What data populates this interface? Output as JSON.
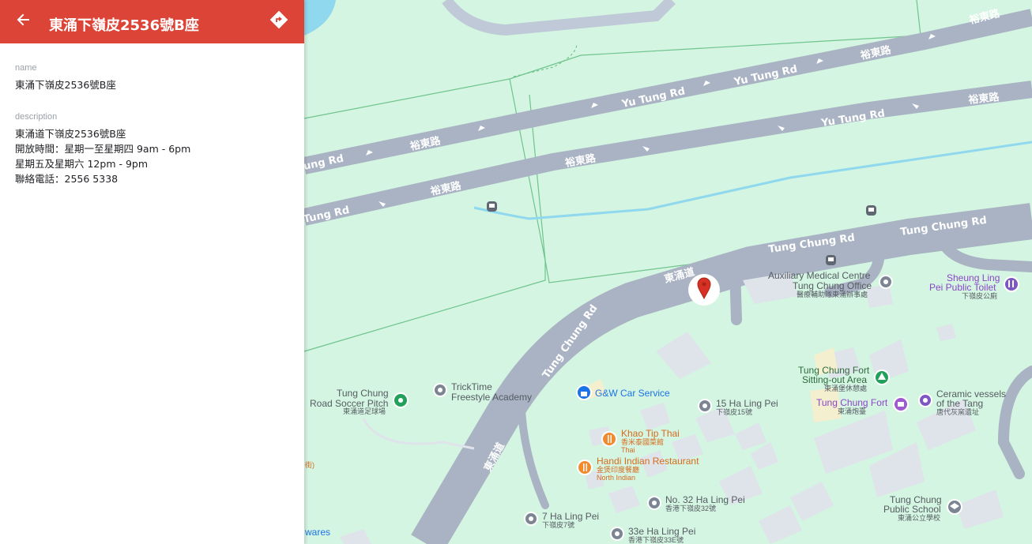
{
  "header": {
    "title": "東涌下嶺皮2536號B座",
    "accent_color": "#db4437",
    "back_icon": "arrow-left-icon",
    "directions_icon": "directions-icon"
  },
  "details": {
    "name_label": "name",
    "name_value": "東涌下嶺皮2536號B座",
    "description_label": "description",
    "description_lines": [
      "東涌道下嶺皮2536號B座",
      "開放時間：星期一至星期四 9am - 6pm",
      "星期五及星期六 12pm - 9pm",
      "聯絡電話：2556 5338"
    ]
  },
  "map": {
    "roads": {
      "yu_tung_en_1": "Yu Tung Rd",
      "yu_tung_en_2": "Yu Tung Rd",
      "yu_tung_en_3": "Yu Tung Rd",
      "yu_tung_en_4": "Yu Tung Rd",
      "yu_tung_en_5": "ung Rd",
      "yu_tung_en_6": "Tung Rd",
      "yu_tung_zh_1": "裕東路",
      "yu_tung_zh_2": "裕東路",
      "yu_tung_zh_3": "裕東路",
      "yu_tung_zh_4": "裕東路",
      "yu_tung_zh_5": "裕東路",
      "tung_chung_en_1": "Tung Chung Rd",
      "tung_chung_en_2": "Tung Chung Rd",
      "tung_chung_en_3": "Tung Chung Rd",
      "tung_chung_zh_1": "東涌道",
      "tung_chung_zh_2": "東涌道"
    },
    "pois": {
      "medical_en_1": "Auxiliary Medical Centre",
      "medical_en_2": "Tung Chung Office",
      "medical_zh": "醫療輔助隊東涌辦事處",
      "toilet_en_1": "Sheung Ling",
      "toilet_en_2": "Pei Public Toilet",
      "toilet_zh": "下嶺皮公廁",
      "pitch_en_1": "Tung Chung",
      "pitch_en_2": "Road Soccer Pitch",
      "pitch_zh": "東涌道足球場",
      "tricktime_1": "TrickTime",
      "tricktime_2": "Freestyle Academy",
      "gw": "G&W Car Service",
      "ha_ling_15_en": "15 Ha Ling Pei",
      "ha_ling_15_zh": "下嶺皮15號",
      "fort_area_en_1": "Tung Chung Fort",
      "fort_area_en_2": "Sitting-out Area",
      "fort_area_zh": "東涌堡休憩處",
      "fort_en": "Tung Chung Fort",
      "fort_zh": "東涌炮臺",
      "ceramic_en_1": "Ceramic vessels",
      "ceramic_en_2": "of the Tang",
      "ceramic_zh": "唐代灰窯遺址",
      "khao_en": "Khao Tip Thai",
      "khao_zh": "香米泰國菜館",
      "khao_type": "Thai",
      "handi_en": "Handi Indian Restaurant",
      "handi_zh": "金煲印度餐廳",
      "handi_type": "North Indian",
      "no32_en": "No. 32 Ha Ling Pei",
      "no32_zh": "香港下嶺皮32號",
      "ha_ling_7_en": "7 Ha Ling Pei",
      "ha_ling_7_zh": "下嶺皮7號",
      "ha_ling_33e_en": "33e Ha Ling Pei",
      "ha_ling_33e_zh": "香港下嶺皮33E號",
      "school_en_1": "Tung Chung",
      "school_en_2": "Public School",
      "school_zh": "東涌公立學校",
      "edge_text_1": "wares",
      "edge_text_2": "街)"
    },
    "icons": {
      "marker": "red-location-pin-icon",
      "bus": "bus-stop-icon",
      "restaurant": "fork-knife-icon",
      "lock": "lock-icon",
      "toilet": "restroom-icon",
      "park": "tree-icon",
      "landmark": "monument-icon",
      "school": "school-icon"
    },
    "colors": {
      "land": "#d4f5e1",
      "road": "#a9b3c3",
      "water": "#8fd8ee",
      "building": "#dfe3ea",
      "marker": "#d93025"
    }
  }
}
